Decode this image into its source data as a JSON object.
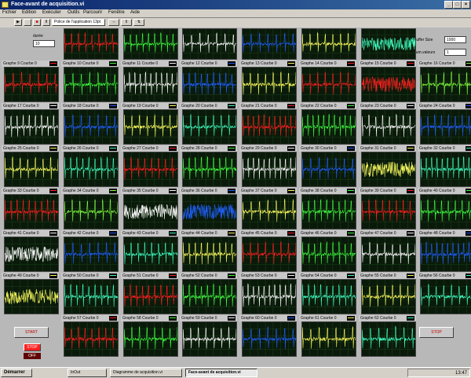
{
  "window": {
    "title": "Face-avant de acquisition.vi",
    "min_label": "_",
    "max_label": "□",
    "close_label": "×"
  },
  "menu": [
    "Fichier",
    "Edition",
    "Exécuter",
    "Outils",
    "Parcourir",
    "Fenêtre",
    "Aide"
  ],
  "toolbar": {
    "font_label": "Police de l'application 13pt",
    "run_label": "▶",
    "stop_label": "■",
    "pause_label": "II",
    "align_label": "⇔",
    "dist_label": "⇕",
    "order_label": "⇅"
  },
  "left": {
    "label_top": "durée",
    "value_top": "10",
    "start_label": "START",
    "stop_small_label": "STOP",
    "led_label": "OFF"
  },
  "right": {
    "buffer_label": "Buffer Size",
    "buffer_value": "1000",
    "num_label": "num.valeurs",
    "num_value": "1",
    "stop_label": "STOP"
  },
  "colors": {
    "red": "#ff2020",
    "green": "#40ff40",
    "white": "#ffffff",
    "blue": "#2060ff",
    "yellow": "#ffff60",
    "teal": "#40ffc0",
    "darkgreen": "#80ff40"
  },
  "graphs": [
    {
      "label": "",
      "color": "red"
    },
    {
      "label": "",
      "color": "green"
    },
    {
      "label": "",
      "color": "white"
    },
    {
      "label": "",
      "color": "blue"
    },
    {
      "label": "",
      "color": "yellow"
    },
    {
      "label": "",
      "color": "teal"
    },
    {
      "label": "Graphe 9 Courbe 0",
      "color": "red"
    },
    {
      "label": "Graphe 10 Courbe 0",
      "color": "green"
    },
    {
      "label": "Graphe 11 Courbe 0",
      "color": "white"
    },
    {
      "label": "Graphe 12 Courbe 0",
      "color": "blue"
    },
    {
      "label": "Graphe 13 Courbe 0",
      "color": "yellow"
    },
    {
      "label": "Graphe 14 Courbe 0",
      "color": "red"
    },
    {
      "label": "Graphe 15 Courbe 0",
      "color": "red"
    },
    {
      "label": "Graphe 16 Courbe 0",
      "color": "darkgreen"
    },
    {
      "label": "Graphe 17 Courbe 0",
      "color": "white"
    },
    {
      "label": "Graphe 18 Courbe 0",
      "color": "blue"
    },
    {
      "label": "Graphe 19 Courbe 0",
      "color": "yellow"
    },
    {
      "label": "Graphe 20 Courbe 0",
      "color": "teal"
    },
    {
      "label": "Graphe 21 Courbe 0",
      "color": "red"
    },
    {
      "label": "Graphe 22 Courbe 0",
      "color": "green"
    },
    {
      "label": "Graphe 23 Courbe 0",
      "color": "white"
    },
    {
      "label": "Graphe 24 Courbe 0",
      "color": "blue"
    },
    {
      "label": "Graphe 25 Courbe 0",
      "color": "yellow"
    },
    {
      "label": "Graphe 26 Courbe 0",
      "color": "teal"
    },
    {
      "label": "Graphe 27 Courbe 0",
      "color": "red"
    },
    {
      "label": "Graphe 28 Courbe 0",
      "color": "green"
    },
    {
      "label": "Graphe 29 Courbe 0",
      "color": "white"
    },
    {
      "label": "Graphe 30 Courbe 0",
      "color": "blue"
    },
    {
      "label": "Graphe 31 Courbe 0",
      "color": "yellow"
    },
    {
      "label": "Graphe 32 Courbe 0",
      "color": "teal"
    },
    {
      "label": "Graphe 33 Courbe 0",
      "color": "red"
    },
    {
      "label": "Graphe 34 Courbe 0",
      "color": "darkgreen"
    },
    {
      "label": "Graphe 35 Courbe 0",
      "color": "white"
    },
    {
      "label": "Graphe 36 Courbe 0",
      "color": "blue"
    },
    {
      "label": "Graphe 37 Courbe 0",
      "color": "yellow"
    },
    {
      "label": "Graphe 38 Courbe 0",
      "color": "green"
    },
    {
      "label": "Graphe 39 Courbe 0",
      "color": "red"
    },
    {
      "label": "Graphe 40 Courbe 0",
      "color": "green"
    },
    {
      "label": "Graphe 41 Courbe 0",
      "color": "white"
    },
    {
      "label": "Graphe 42 Courbe 0",
      "color": "blue"
    },
    {
      "label": "Graphe 43 Courbe 0",
      "color": "teal"
    },
    {
      "label": "Graphe 44 Courbe 0",
      "color": "yellow"
    },
    {
      "label": "Graphe 45 Courbe 0",
      "color": "red"
    },
    {
      "label": "Graphe 46 Courbe 0",
      "color": "green"
    },
    {
      "label": "Graphe 47 Courbe 0",
      "color": "white"
    },
    {
      "label": "Graphe 48 Courbe 0",
      "color": "blue"
    },
    {
      "label": "Graphe 49 Courbe 0",
      "color": "yellow"
    },
    {
      "label": "Graphe 50 Courbe 0",
      "color": "teal"
    },
    {
      "label": "Graphe 51 Courbe 0",
      "color": "red"
    },
    {
      "label": "Graphe 52 Courbe 0",
      "color": "green"
    },
    {
      "label": "Graphe 53 Courbe 0",
      "color": "white"
    },
    {
      "label": "Graphe 54 Courbe 0",
      "color": "teal"
    },
    {
      "label": "Graphe 55 Courbe 0",
      "color": "yellow"
    },
    {
      "label": "Graphe 56 Courbe 0",
      "color": "teal"
    },
    {
      "label": "Graphe 57 Courbe 0",
      "color": "red"
    },
    {
      "label": "Graphe 58 Courbe 0",
      "color": "green"
    },
    {
      "label": "Graphe 59 Courbe 0",
      "color": "white"
    },
    {
      "label": "Graphe 60 Courbe 0",
      "color": "blue"
    },
    {
      "label": "Graphe 61 Courbe 0",
      "color": "yellow"
    },
    {
      "label": "Graphe 62 Courbe 0",
      "color": "teal"
    },
    {
      "label": "Graphe 63 Courbe 0",
      "color": "red"
    },
    {
      "label": "Graphe 64 Courbe 0",
      "color": "green"
    }
  ],
  "taskbar": {
    "start_label": "Démarrer",
    "tasks": [
      "InOut",
      "Diagramme de acquisition.vi",
      "Face-avant de acquisition.vi"
    ],
    "clock": "13:47"
  }
}
